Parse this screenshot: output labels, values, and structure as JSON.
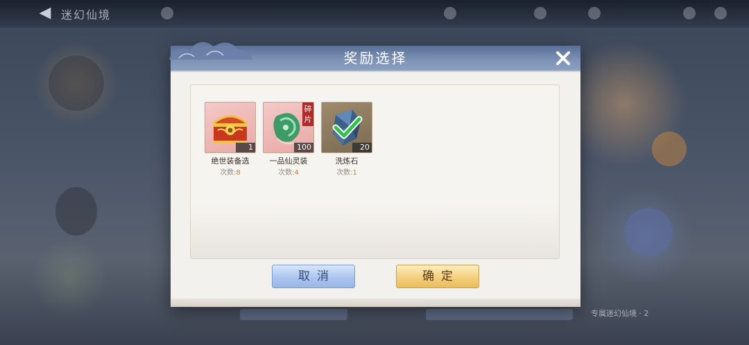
{
  "background": {
    "stage_label": "迷幻仙境",
    "hint_text": "专属迷幻仙境 · 2"
  },
  "dialog": {
    "title": "奖励选择",
    "count_prefix": "次数:",
    "items": [
      {
        "name": "绝世装备选",
        "quantity": "1",
        "count": "8",
        "icon": "treasure-chest-icon",
        "frame": "pink"
      },
      {
        "name": "一品仙灵装",
        "quantity": "100",
        "count": "4",
        "icon": "jade-fragment-icon",
        "frame": "pink",
        "badge": "碎片"
      },
      {
        "name": "洗炼石",
        "quantity": "20",
        "count": "1",
        "icon": "refining-stone-icon",
        "frame": "brown",
        "selected": true
      }
    ],
    "cancel_label": "取消",
    "confirm_label": "确定"
  },
  "colors": {
    "header": "#6f84aa",
    "cancel": "#a9c3ee",
    "confirm": "#f2cd78",
    "count_number": "#d07a28",
    "check": "#2fc24a"
  }
}
